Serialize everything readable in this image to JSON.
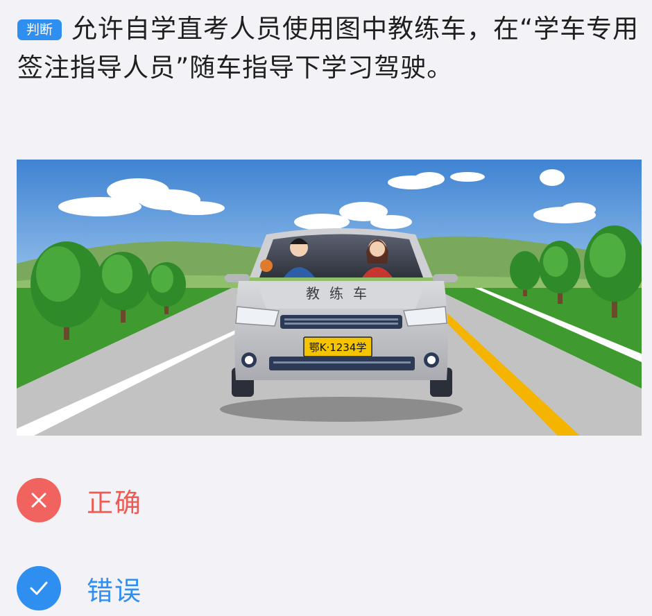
{
  "question": {
    "type_tag": "判断",
    "text": "允许自学直考人员使用图中教练车，在“学车专用签注指导人员”随车指导下学习驾驶。"
  },
  "illustration": {
    "car_hood_text": "教练车",
    "plate_text": "鄂K·1234学",
    "colors": {
      "sky": "#4d8fd6",
      "grass": "#3f9a2f",
      "road": "#c2c2c2",
      "center_line": "#f5b400"
    }
  },
  "options": [
    {
      "label": "正确",
      "state": "selected-wrong",
      "icon": "close-icon",
      "color": "#f0635f"
    },
    {
      "label": "错误",
      "state": "correct-answer",
      "icon": "check-icon",
      "color": "#2f8ff0"
    }
  ]
}
